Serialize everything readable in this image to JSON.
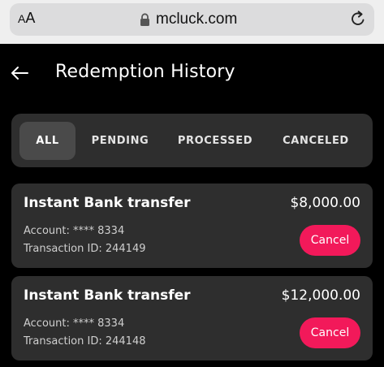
{
  "browser": {
    "text_size_label_large": "A",
    "text_size_label_small": "A",
    "url": "mcluck.com",
    "icons": {
      "lock": "lock-icon",
      "reload": "reload-icon"
    }
  },
  "header": {
    "title": "Redemption History",
    "back_icon": "arrow-left-icon"
  },
  "tabs": [
    {
      "label": "ALL",
      "active": true
    },
    {
      "label": "PENDING",
      "active": false
    },
    {
      "label": "PROCESSED",
      "active": false
    },
    {
      "label": "CANCELED",
      "active": false
    }
  ],
  "transactions": [
    {
      "method": "Instant Bank transfer",
      "amount": "$8,000.00",
      "account": "Account: **** 8334",
      "transaction_id": "Transaction ID: 244149",
      "action_label": "Cancel"
    },
    {
      "method": "Instant Bank transfer",
      "amount": "$12,000.00",
      "account": "Account: **** 8334",
      "transaction_id": "Transaction ID: 244148",
      "action_label": "Cancel"
    }
  ],
  "colors": {
    "background": "#000000",
    "card": "#2e2e2e",
    "active_tab": "#4a4a4a",
    "accent": "#f2195a",
    "browser_bar": "#efefef"
  }
}
